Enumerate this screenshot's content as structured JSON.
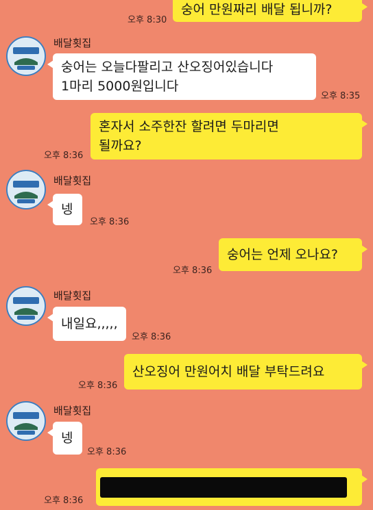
{
  "sender_name": "배달횟집",
  "messages": [
    {
      "from": "me",
      "text": "숭어 만원짜리 배달 됩니까?",
      "time": "오후 8:30"
    },
    {
      "from": "other",
      "text": "숭어는 오늘다팔리고 산오징어있습니다\n1마리 5000원입니다",
      "time": "오후 8:35"
    },
    {
      "from": "me",
      "text": "혼자서 소주한잔 할려면 두마리면\n될까요?",
      "time": "오후 8:36"
    },
    {
      "from": "other",
      "text": "넹",
      "time": "오후 8:36"
    },
    {
      "from": "me",
      "text": "숭어는 언제 오나요?",
      "time": "오후 8:36"
    },
    {
      "from": "other",
      "text": "내일요,,,,,",
      "time": "오후 8:36"
    },
    {
      "from": "me",
      "text": "산오징어 만원어치 배달 부탁드려요",
      "time": "오후 8:36"
    },
    {
      "from": "other",
      "text": "넹",
      "time": "오후 8:36"
    },
    {
      "from": "me",
      "text": "",
      "time": "오후 8:36",
      "redacted": true
    }
  ],
  "colors": {
    "background": "#F0876C",
    "my_bubble": "#FDEB36",
    "their_bubble": "#FFFFFF",
    "avatar_ring": "#3E7FC0"
  },
  "icons": {
    "avatar": "restaurant-logo-avatar"
  }
}
